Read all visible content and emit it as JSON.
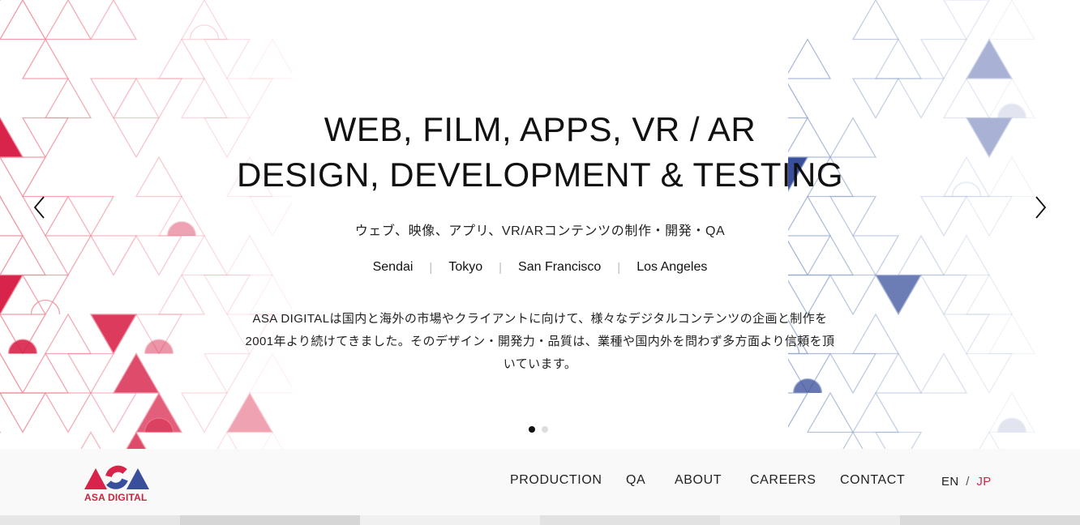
{
  "hero": {
    "headline_line1": "WEB, FILM, APPS, VR / AR",
    "headline_line2": "DESIGN, DEVELOPMENT & TESTING",
    "subtitle_jp": "ウェブ、映像、アプリ、VR/ARコンテンツの制作・開発・QA",
    "cities": [
      "Sendai",
      "Tokyo",
      "San Francisco",
      "Los Angeles"
    ],
    "separator": "|",
    "description": "ASA DIGITALは国内と海外の市場やクライアントに向けて、様々なデジタルコンテンツの企画と制作を2001年より続けてきました。そのデザイン・開発力・品質は、業種や国内外を問わず多方面より信頼を頂いています。",
    "slides_total": 2,
    "slide_active": 1
  },
  "nav": {
    "logo_text": "ASA DIGITAL",
    "items": [
      "PRODUCTION",
      "QA",
      "ABOUT",
      "CAREERS",
      "CONTACT"
    ],
    "lang_en": "EN",
    "lang_sep": "/",
    "lang_jp": "JP"
  },
  "colors": {
    "brand_red": "#d8234a",
    "brand_blue": "#3a4f9c",
    "pattern_pink": "#f08a9a",
    "pattern_blue": "#8ea3cc"
  },
  "icons": {
    "prev": "chevron-left-icon",
    "next": "chevron-right-icon"
  }
}
